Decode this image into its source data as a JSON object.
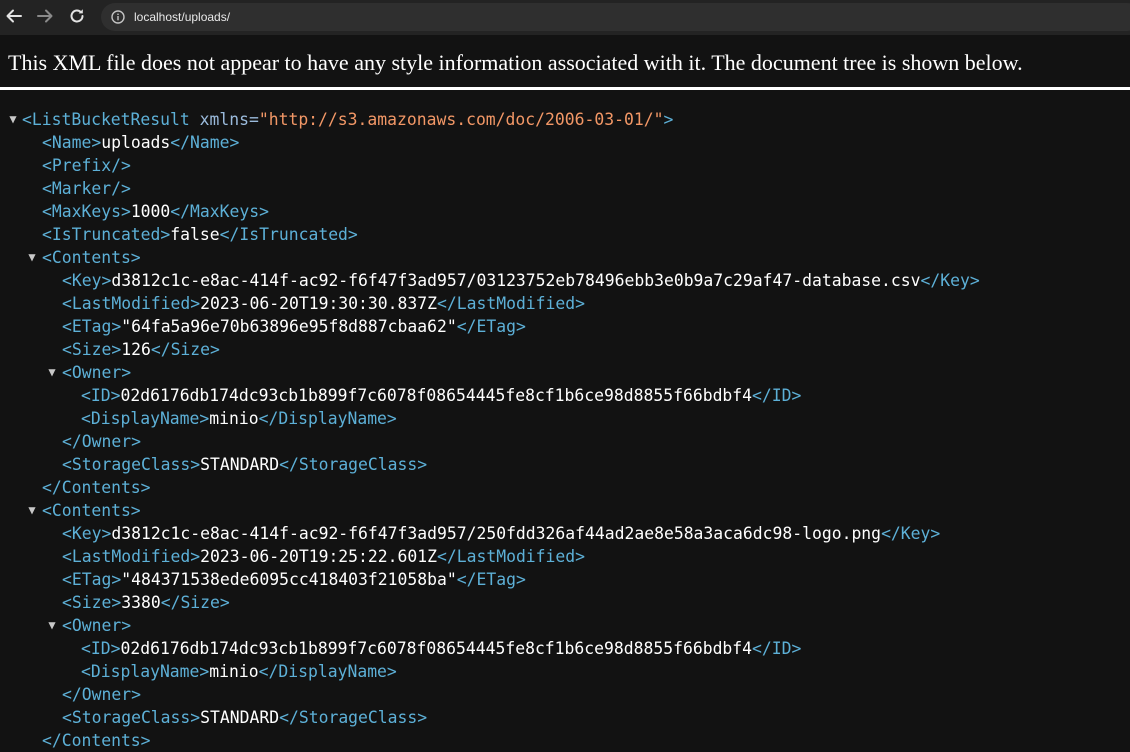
{
  "browser": {
    "url": "localhost/uploads/"
  },
  "banner": {
    "text": "This XML file does not appear to have any style information associated with it. The document tree is shown below."
  },
  "xml": {
    "root_open": "<ListBucketResult",
    "root_attr_name": " xmlns=",
    "root_attr_value": "\"http://s3.amazonaws.com/doc/2006-03-01/\"",
    "root_close_bracket": ">",
    "name": {
      "open": "<Name>",
      "value": "uploads",
      "close": "</Name>"
    },
    "prefix": "<Prefix/>",
    "marker": "<Marker/>",
    "max_keys": {
      "open": "<MaxKeys>",
      "value": "1000",
      "close": "</MaxKeys>"
    },
    "is_truncated": {
      "open": "<IsTruncated>",
      "value": "false",
      "close": "</IsTruncated>"
    },
    "contents": [
      {
        "open": "<Contents>",
        "close": "</Contents>",
        "key": {
          "open": "<Key>",
          "value": "d3812c1c-e8ac-414f-ac92-f6f47f3ad957/03123752eb78496ebb3e0b9a7c29af47-database.csv",
          "close": "</Key>"
        },
        "last_modified": {
          "open": "<LastModified>",
          "value": "2023-06-20T19:30:30.837Z",
          "close": "</LastModified>"
        },
        "etag": {
          "open": "<ETag>",
          "value": "\"64fa5a96e70b63896e95f8d887cbaa62\"",
          "close": "</ETag>"
        },
        "size": {
          "open": "<Size>",
          "value": "126",
          "close": "</Size>"
        },
        "owner": {
          "open": "<Owner>",
          "close": "</Owner>",
          "id": {
            "open": "<ID>",
            "value": "02d6176db174dc93cb1b899f7c6078f08654445fe8cf1b6ce98d8855f66bdbf4",
            "close": "</ID>"
          },
          "display_name": {
            "open": "<DisplayName>",
            "value": "minio",
            "close": "</DisplayName>"
          }
        },
        "storage_class": {
          "open": "<StorageClass>",
          "value": "STANDARD",
          "close": "</StorageClass>"
        }
      },
      {
        "open": "<Contents>",
        "close": "</Contents>",
        "key": {
          "open": "<Key>",
          "value": "d3812c1c-e8ac-414f-ac92-f6f47f3ad957/250fdd326af44ad2ae8e58a3aca6dc98-logo.png",
          "close": "</Key>"
        },
        "last_modified": {
          "open": "<LastModified>",
          "value": "2023-06-20T19:25:22.601Z",
          "close": "</LastModified>"
        },
        "etag": {
          "open": "<ETag>",
          "value": "\"484371538ede6095cc418403f21058ba\"",
          "close": "</ETag>"
        },
        "size": {
          "open": "<Size>",
          "value": "3380",
          "close": "</Size>"
        },
        "owner": {
          "open": "<Owner>",
          "close": "</Owner>",
          "id": {
            "open": "<ID>",
            "value": "02d6176db174dc93cb1b899f7c6078f08654445fe8cf1b6ce98d8855f66bdbf4",
            "close": "</ID>"
          },
          "display_name": {
            "open": "<DisplayName>",
            "value": "minio",
            "close": "</DisplayName>"
          }
        },
        "storage_class": {
          "open": "<StorageClass>",
          "value": "STANDARD",
          "close": "</StorageClass>"
        }
      }
    ]
  }
}
